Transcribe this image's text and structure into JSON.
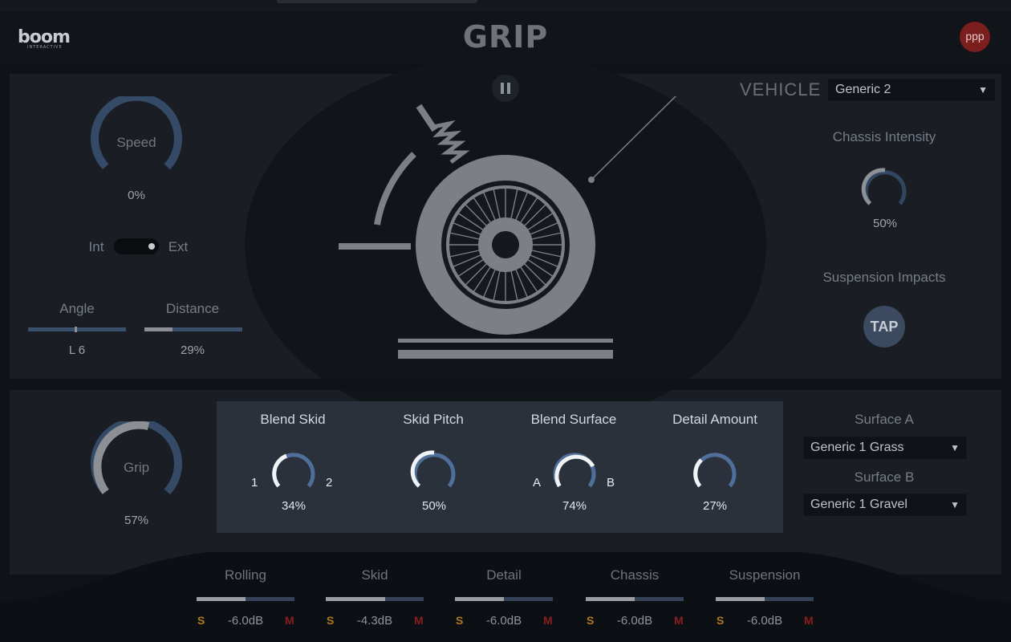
{
  "header": {
    "logo": "boom",
    "logo_sub": "INTERACTIVE",
    "title": "GRIP",
    "badge": "ppp"
  },
  "left": {
    "speed_label": "Speed",
    "speed_value": "0%",
    "speed_level": 0,
    "toggle_left": "Int",
    "toggle_right": "Ext",
    "angle_label": "Angle",
    "angle_value": "L 6",
    "distance_label": "Distance",
    "distance_value": "29%",
    "distance_level": 0.29
  },
  "right": {
    "vehicle_label": "VEHICLE",
    "vehicle_value": "Generic 2",
    "chassis_label": "Chassis Intensity",
    "chassis_value": "50%",
    "chassis_level": 0.5,
    "suspension_label": "Suspension Impacts",
    "tap_label": "TAP"
  },
  "grip": {
    "label": "Grip",
    "value": "57%",
    "level": 0.57
  },
  "blend": {
    "skid": {
      "label": "Blend Skid",
      "value": "34%",
      "left": "1",
      "right": "2",
      "level": 0.34
    },
    "pitch": {
      "label": "Skid Pitch",
      "value": "50%",
      "level": 0.5
    },
    "surface": {
      "label": "Blend Surface",
      "value": "74%",
      "left": "A",
      "right": "B",
      "level": 0.74
    },
    "detail": {
      "label": "Detail Amount",
      "value": "27%",
      "level": 0.27
    }
  },
  "surfaces": {
    "a_label": "Surface A",
    "a_value": "Generic 1 Grass",
    "b_label": "Surface B",
    "b_value": "Generic 1 Gravel"
  },
  "mixer": [
    {
      "label": "Rolling",
      "solo": "S",
      "db": "-6.0dB",
      "mute": "M",
      "level": 0.5
    },
    {
      "label": "Skid",
      "solo": "S",
      "db": "-4.3dB",
      "mute": "M",
      "level": 0.61
    },
    {
      "label": "Detail",
      "solo": "S",
      "db": "-6.0dB",
      "mute": "M",
      "level": 0.5
    },
    {
      "label": "Chassis",
      "solo": "S",
      "db": "-6.0dB",
      "mute": "M",
      "level": 0.5
    },
    {
      "label": "Suspension",
      "solo": "S",
      "db": "-6.0dB",
      "mute": "M",
      "level": 0.5
    }
  ],
  "colors": {
    "accent": "#4f6f9a",
    "track": "#8b8f94",
    "solo": "#b07a1e",
    "mute": "#8a1e1e"
  },
  "icons": {
    "pause": "pause-icon",
    "dropdown": "chevron-down-icon",
    "illustration": "wheel-suspension-illustration"
  }
}
